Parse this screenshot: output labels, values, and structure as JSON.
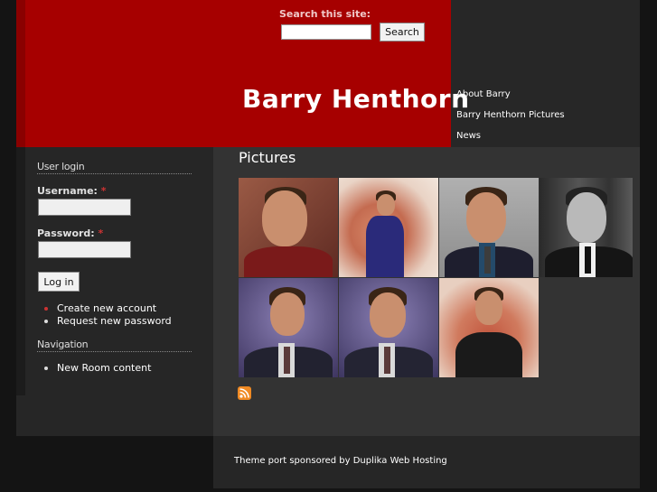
{
  "header": {
    "search_label": "Search this site:",
    "search_value": "",
    "search_button": "Search",
    "site_name": "Barry Henthorn"
  },
  "primary_links": [
    "About Barry",
    "Barry Henthorn Pictures",
    "News"
  ],
  "sidebar": {
    "user_login": {
      "title": "User login",
      "username_label": "Username:",
      "password_label": "Password:",
      "required_mark": "*",
      "login_button": "Log in",
      "links": [
        "Create new account",
        "Request new password"
      ]
    },
    "navigation": {
      "title": "Navigation",
      "links": [
        "New Room content"
      ]
    }
  },
  "main": {
    "title": "Pictures"
  },
  "footer": {
    "text": "Theme port sponsored by Duplika Web Hosting"
  },
  "colors": {
    "header_red": "#a60000",
    "bullet_red": "#cc3333",
    "feed_orange": "#f08a24"
  }
}
